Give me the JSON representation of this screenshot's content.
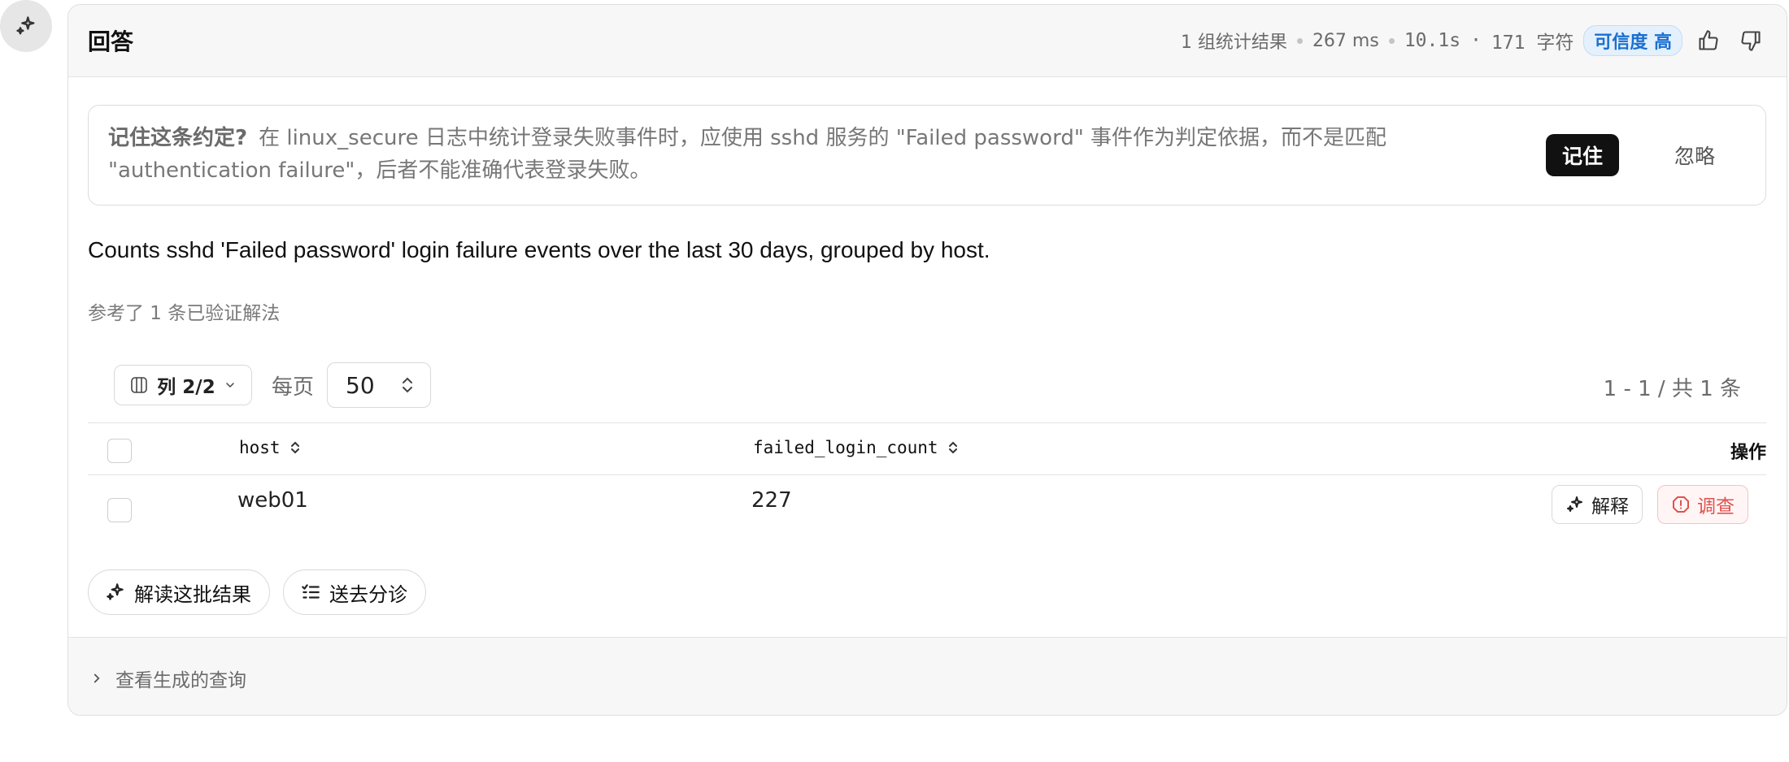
{
  "header": {
    "title": "回答",
    "stat_result": "1 组统计结果",
    "stat_ms": "267 ms",
    "stat_time": "10.1s",
    "stat_sep": "·",
    "stat_chars": "171 字符",
    "confidence_badge": "可信度 高"
  },
  "suggestion": {
    "question": "记住这条约定?",
    "body": "在 linux_secure 日志中统计登录失败事件时，应使用 sshd 服务的 \"Failed password\" 事件作为判定依据，而不是匹配 \"authentication failure\"，后者不能准确代表登录失败。",
    "remember_label": "记住",
    "ignore_label": "忽略"
  },
  "description": "Counts sshd 'Failed password' login failure events over the last 30 days, grouped by host.",
  "reference_note": "参考了 1 条已验证解法",
  "toolbar": {
    "columns_label": "列 2/2",
    "per_page_label": "每页",
    "per_page_value": "50",
    "pagination": "1 - 1 / 共 1 条"
  },
  "table": {
    "columns": [
      "host",
      "failed_login_count",
      "操作"
    ],
    "rows": [
      {
        "host": "web01",
        "failed_login_count": "227"
      }
    ],
    "explain_label": "解释",
    "investigate_label": "调查"
  },
  "actions": {
    "interpret_label": "解读这批结果",
    "triage_label": "送去分诊"
  },
  "footer": {
    "query_toggle_label": "查看生成的查询"
  },
  "colors": {
    "badge_text": "#1a6fd1",
    "badge_bg": "#e4f0fc",
    "danger": "#e0524d",
    "primary_button": "#111111"
  }
}
